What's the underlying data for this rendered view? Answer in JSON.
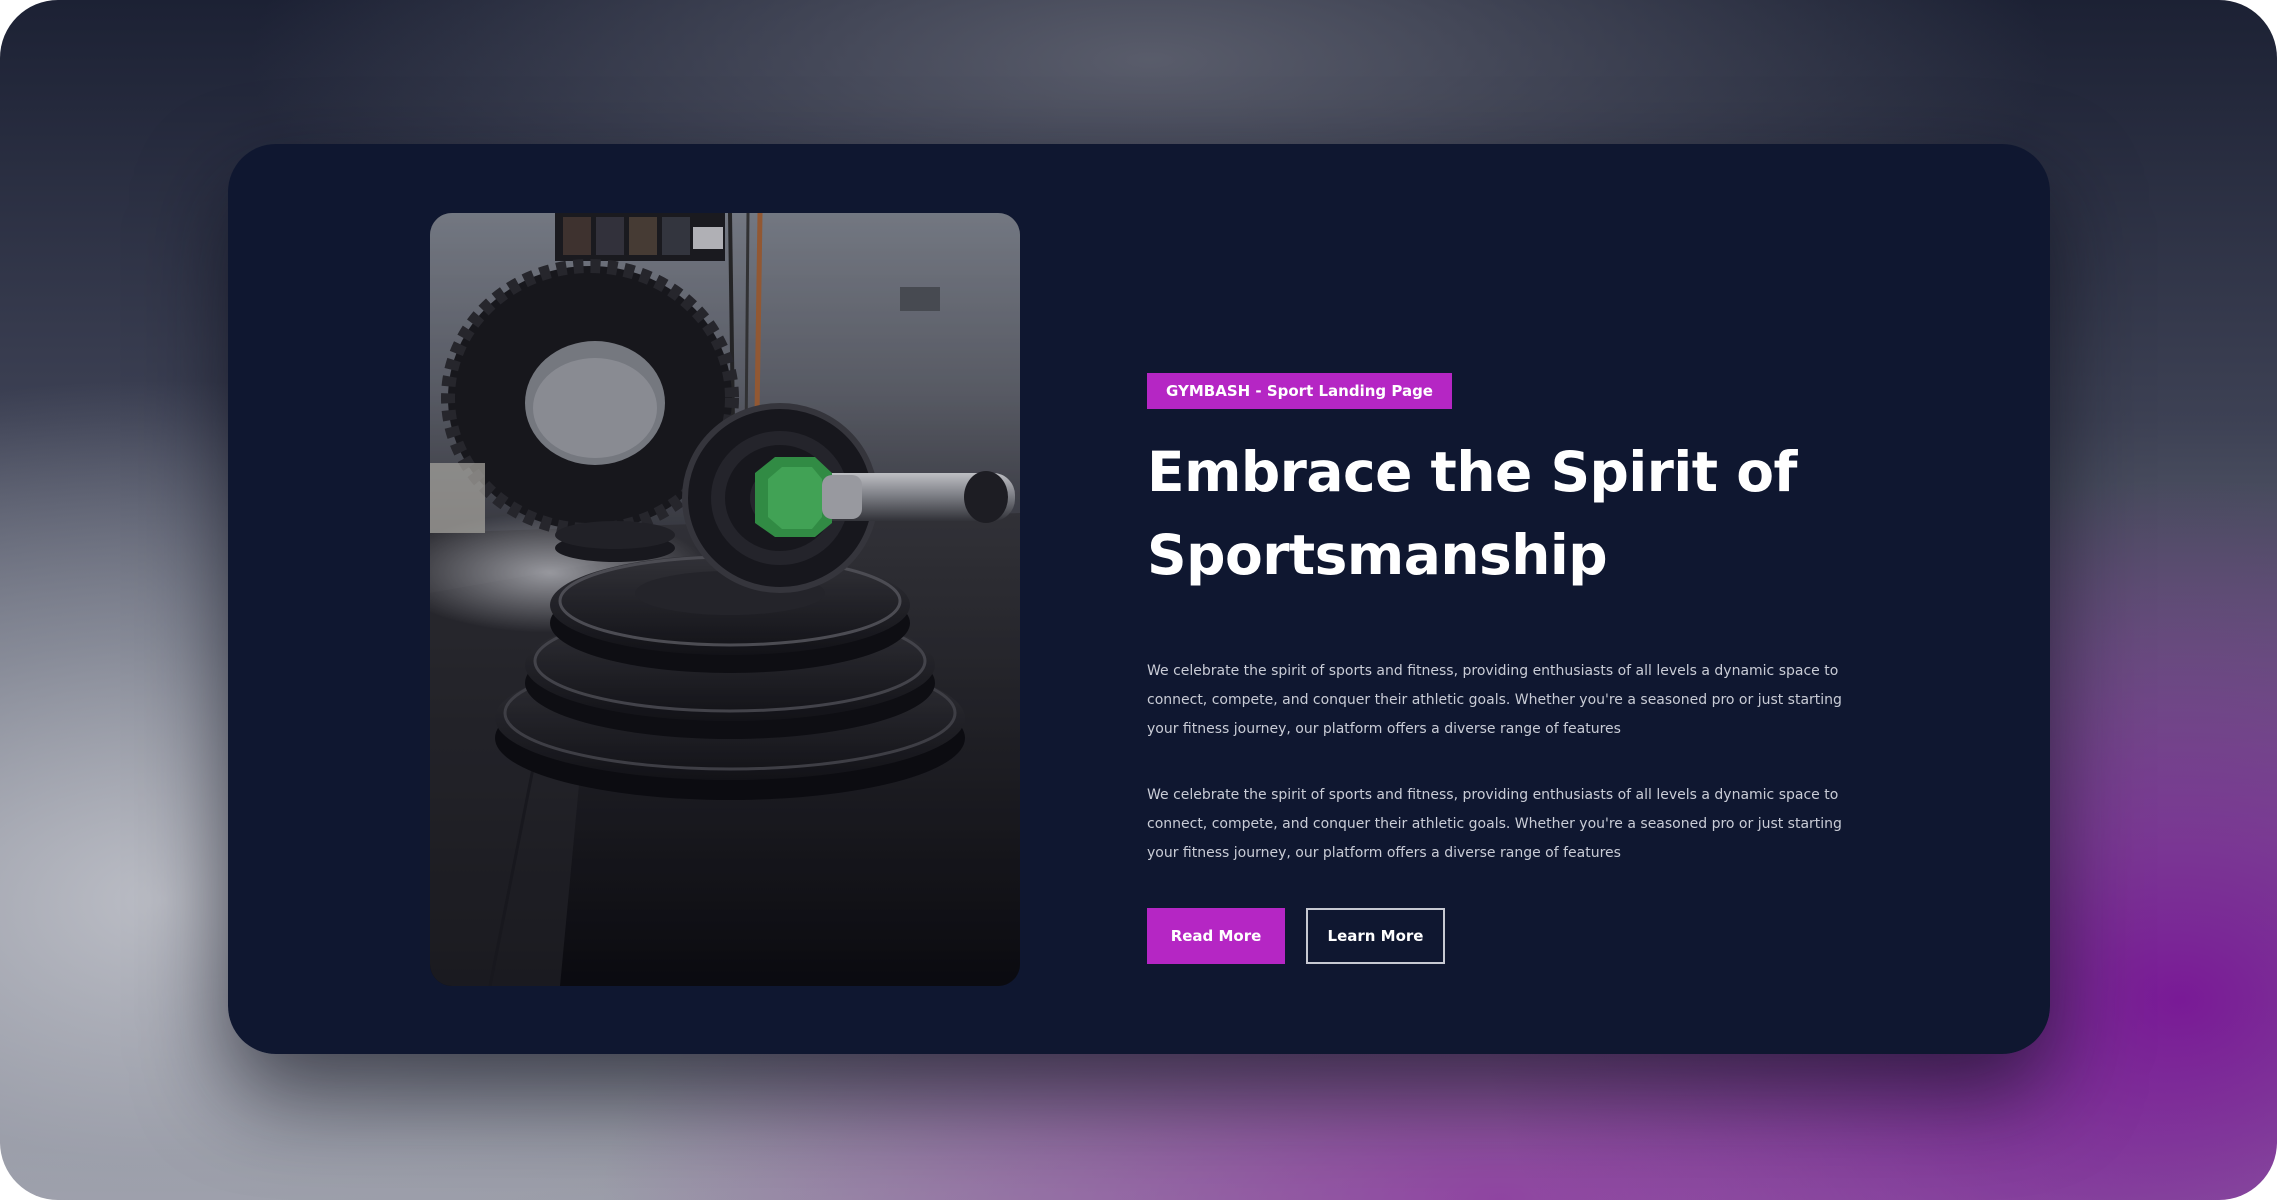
{
  "hero": {
    "tag": "GYMBASH - Sport Landing Page",
    "headline_line1": "Embrace the Spirit of",
    "headline_line2": "Sportsmanship",
    "paragraph1": "We celebrate the spirit of sports and fitness, providing enthusiasts of all levels a dynamic space to connect, compete, and conquer their athletic goals. Whether you're a seasoned pro or just starting your fitness journey, our platform offers a diverse range of features",
    "paragraph2": "We celebrate the spirit of sports and fitness, providing enthusiasts of all levels a dynamic space to connect, compete, and conquer their athletic goals. Whether you're a seasoned pro or just starting your fitness journey, our platform offers a diverse range of features",
    "primary_button": "Read More",
    "secondary_button": "Learn More"
  },
  "colors": {
    "accent": "#b526c4",
    "card_background": "#0f1730",
    "text_primary": "#ffffff",
    "text_secondary": "#c9ccd6"
  },
  "image": {
    "subject": "barbell-with-weight-plates-in-gym"
  }
}
